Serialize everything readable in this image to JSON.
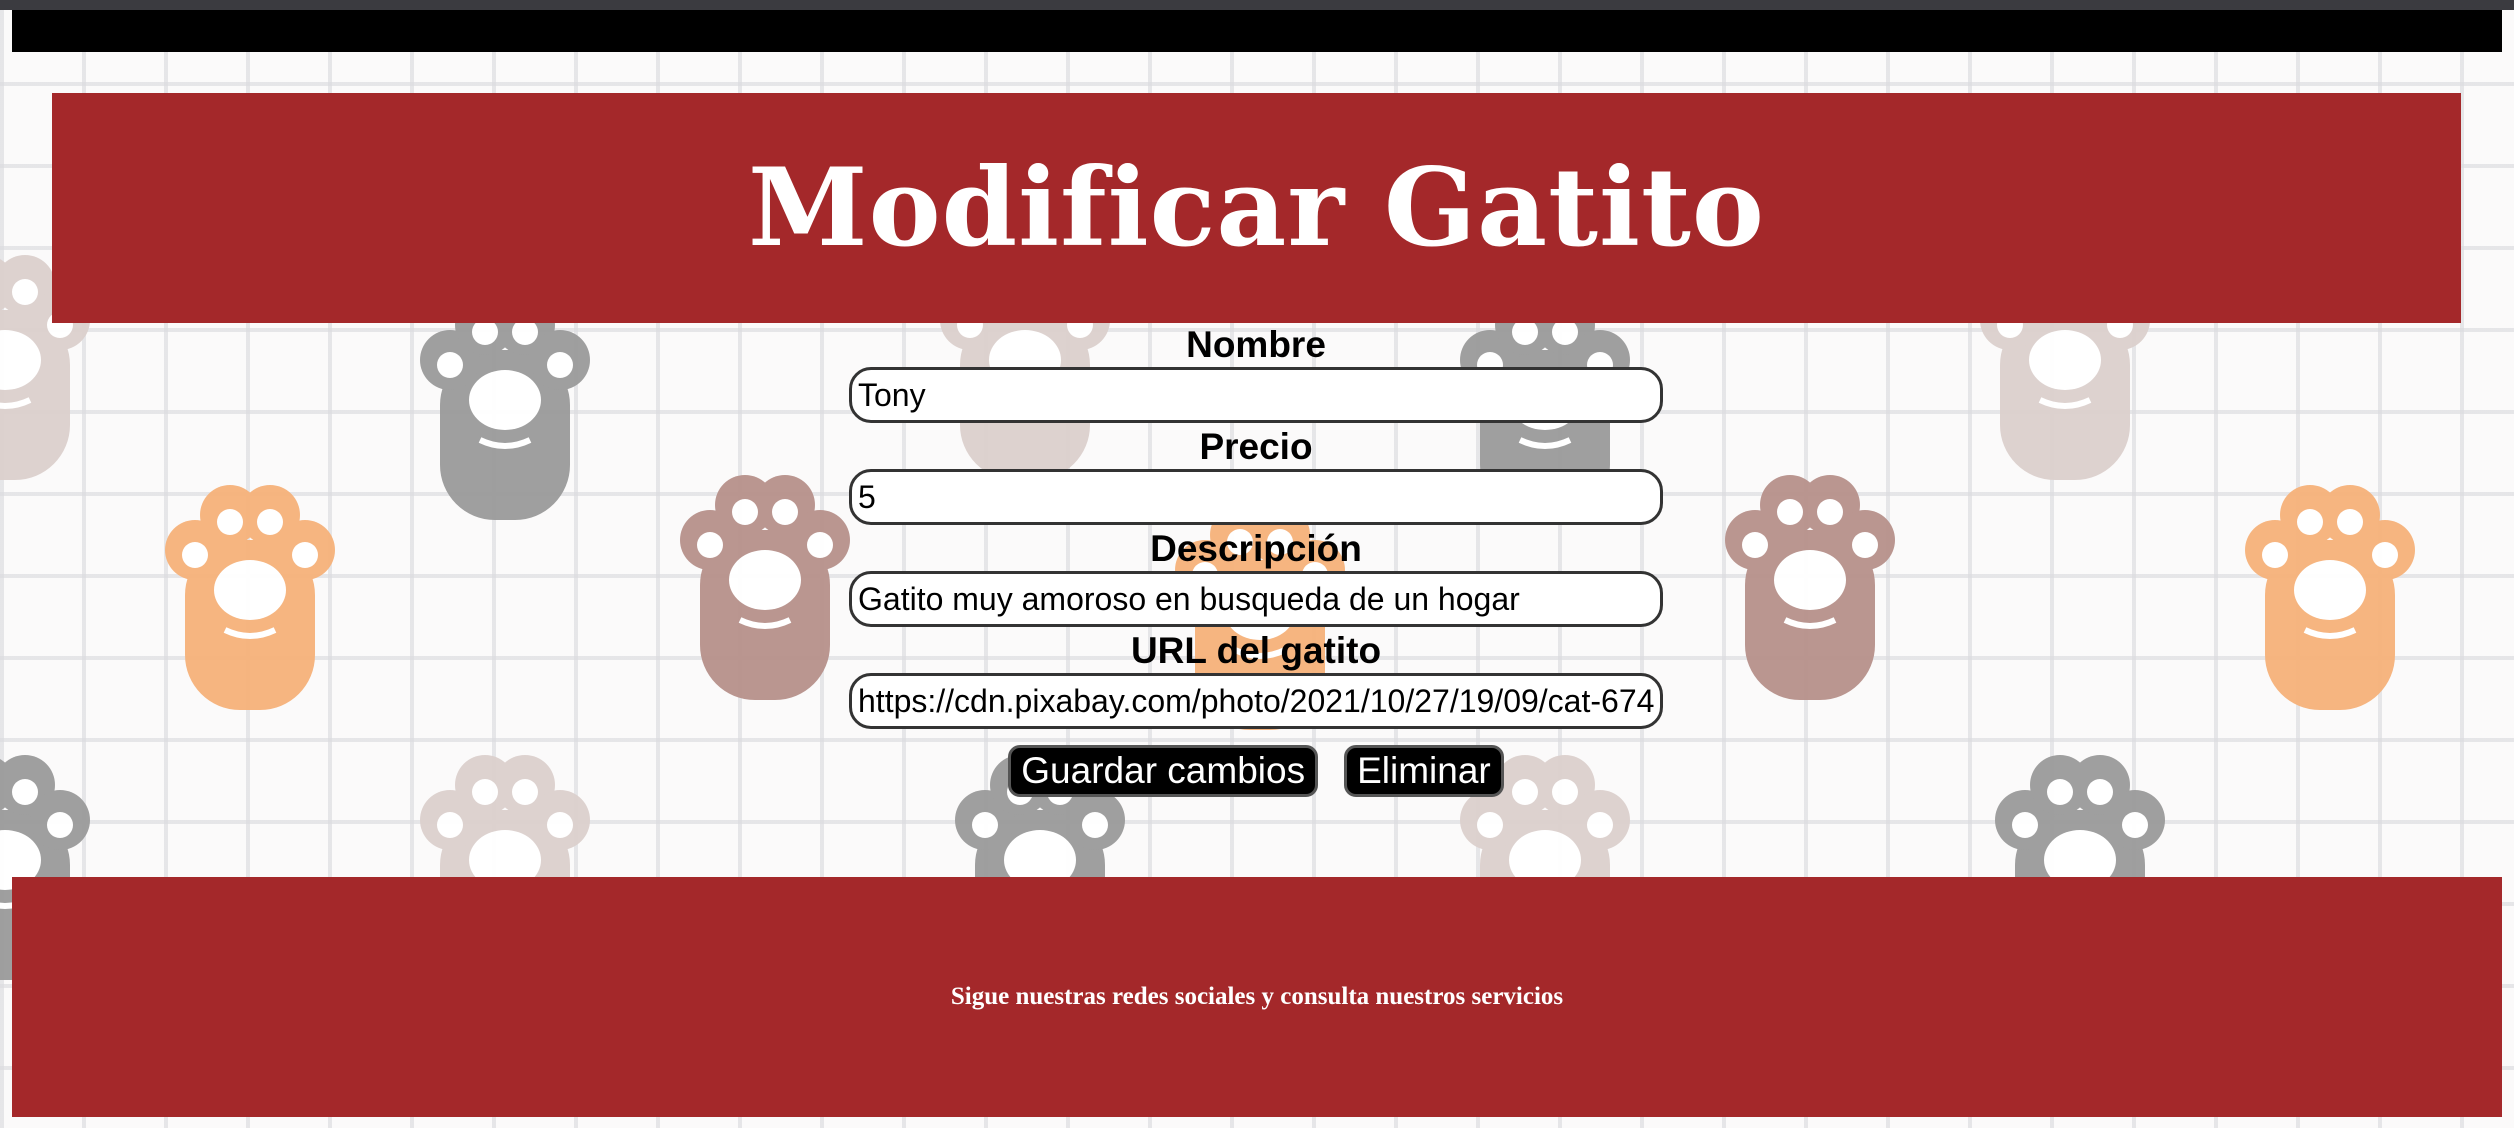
{
  "page": {
    "title": "Modificar Gatito"
  },
  "form": {
    "nombre": {
      "label": "Nombre",
      "value": "Tony"
    },
    "precio": {
      "label": "Precio",
      "value": "5"
    },
    "descripcion": {
      "label": "Descripción",
      "value": "Gatito muy amoroso en busqueda de un hogar"
    },
    "url": {
      "label": "URL del gatito",
      "value": "https://cdn.pixabay.com/photo/2021/10/27/19/09/cat-674"
    }
  },
  "buttons": {
    "save_label": "Guardar cambios",
    "delete_label": "Eliminar"
  },
  "footer": {
    "text": "Sigue nuestras redes sociales y consulta nuestros servicios"
  },
  "colors": {
    "header_bg": "#a4282a",
    "footer_bg": "#a4282a",
    "topbar": "#000000",
    "paw_orange": "#f6b27a",
    "paw_brown": "#b7918b",
    "paw_gray": "#9a9a9a",
    "paw_light": "#dcd0cd"
  }
}
